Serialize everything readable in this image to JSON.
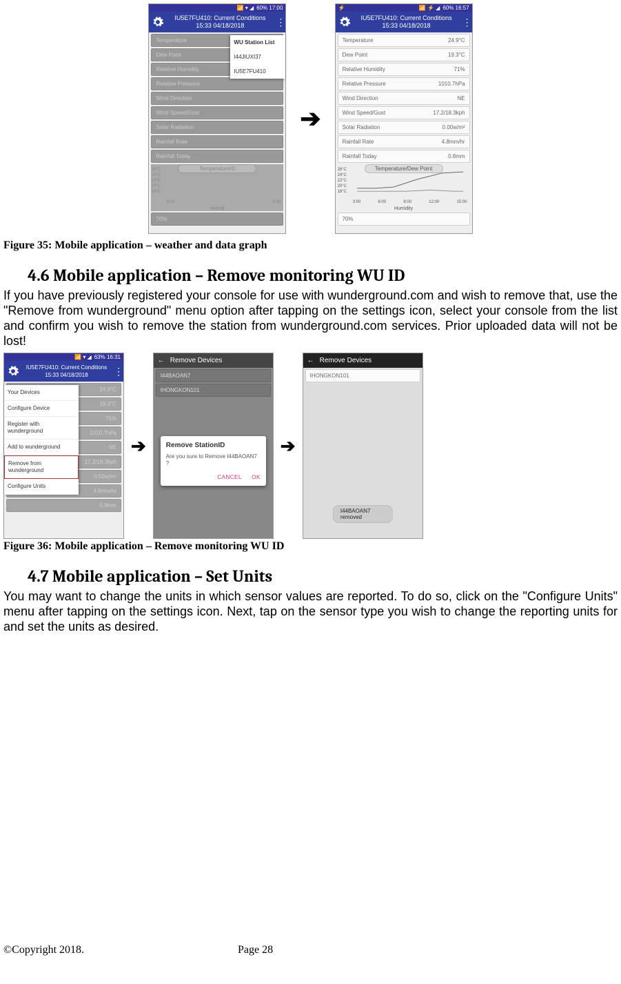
{
  "chart_data": {
    "type": "line",
    "title": "Temperature/Dew Point",
    "xlabel": "Humidity",
    "x_ticks": [
      "3:00",
      "6:00",
      "9:00",
      "12:00",
      "15:00"
    ],
    "y_ticks": [
      "26°C",
      "24°C",
      "22°C",
      "20°C",
      "18°C"
    ],
    "ylim": [
      18,
      26
    ],
    "series": [
      {
        "name": "Temperature",
        "values": [
          20,
          20,
          20.5,
          22,
          24,
          25
        ]
      },
      {
        "name": "Dew Point",
        "values": [
          19,
          19,
          19,
          19.5,
          19,
          19
        ]
      }
    ]
  },
  "fig35": {
    "caption": "Figure 35: Mobile application – weather and data graph",
    "left": {
      "status_right": "60% 17:00",
      "status_prefix": "📶 ▾ ◢",
      "title_line1": "IU5E7FU410: Current Conditions",
      "title_line2": "15:33    04/18/2018",
      "rows": [
        {
          "label": "Temperature",
          "value": ""
        },
        {
          "label": "Dew Point",
          "value": ""
        },
        {
          "label": "Relative Humidity",
          "value": ""
        },
        {
          "label": "Relative Pressure",
          "value": ""
        },
        {
          "label": "Wind Direction",
          "value": ""
        },
        {
          "label": "Wind Speed/Gust",
          "value": ""
        },
        {
          "label": "Solar Radiation",
          "value": ""
        },
        {
          "label": "Rainfall Rate",
          "value": ""
        },
        {
          "label": "Rainfall Today",
          "value": ""
        }
      ],
      "graph_title": "Temperature/D",
      "axis_title": "Humid",
      "bottom_bar": "70%",
      "menu_header": "WU Station List",
      "menu_items": [
        "I44JIUXI37",
        "IU5E7FU410"
      ]
    },
    "right": {
      "status_right": "60% 16:57",
      "status_prefix": "📶 ⚡ ◢",
      "title_line1": "IU5E7FU410: Current Conditions",
      "title_line2": "15:33    04/18/2018",
      "rows": [
        {
          "label": "Temperature",
          "value": "24.9°C"
        },
        {
          "label": "Dew Point",
          "value": "19.3°C"
        },
        {
          "label": "Relative Humidity",
          "value": "71%"
        },
        {
          "label": "Relative Pressure",
          "value": "1010.7hPa"
        },
        {
          "label": "Wind Direction",
          "value": "NE"
        },
        {
          "label": "Wind Speed/Gust",
          "value": "17.2/18.3kph"
        },
        {
          "label": "Solar Radiation",
          "value": "0.00w/m²"
        },
        {
          "label": "Rainfall Rate",
          "value": "4.8mm/hr"
        },
        {
          "label": "Rainfall Today",
          "value": "0.8mm"
        }
      ],
      "graph_title": "Temperature/Dew Point",
      "axis_title": "Humidity",
      "bottom_bar": "70%"
    }
  },
  "section46": {
    "heading": "4.6 Mobile application – Remove monitoring WU ID",
    "body": "If you have previously registered your console for use with wunderground.com and wish to remove that, use the \"Remove from wunderground\" menu option after tapping on the settings icon, select your console from the list and confirm you wish to remove the station from wunderground.com services. Prior uploaded data will not be lost!"
  },
  "fig36": {
    "caption": "Figure 36: Mobile application – Remove monitoring WU ID",
    "left": {
      "status_right": "63% 16:31",
      "status_prefix": "📶 ▾ ◢",
      "title_line1": "IU5E7FU410: Current Conditions",
      "title_line2": "15:33    04/18/2018",
      "back_values": [
        "24.9°C",
        "19.3°C",
        "71%",
        "1010.7hPa",
        "NE",
        "17.2/18.3kph",
        "0.50w/m²",
        "4.8mm/hr",
        "0.8mm"
      ],
      "drawer": [
        "Your Devices",
        "Configure Device",
        "Register with\nwunderground",
        "Add to wunderground",
        "Remove from\nwunderground",
        "Configure Units"
      ],
      "drawer_selected_index": 4
    },
    "mid": {
      "header": "Remove Devices",
      "items": [
        "I44BAOAN7",
        "IHONGKON101"
      ],
      "dialog_title": "Remove StationID",
      "dialog_body": "Are you sure to Remove I44BAOAN7 ?",
      "dialog_cancel": "CANCEL",
      "dialog_ok": "OK"
    },
    "right": {
      "header": "Remove Devices",
      "items": [
        "IHONGKON101"
      ],
      "toast": "I44BAOAN7 removed"
    }
  },
  "section47": {
    "heading": "4.7 Mobile application – Set Units",
    "body": "You may want to change the units in which sensor values are reported. To do so, click on the \"Configure Units\" menu after tapping on the settings icon. Next, tap on the sensor type you wish to change the reporting units for and set the units as desired."
  },
  "footer": {
    "copyright": "©Copyright 2018.",
    "page": "Page 28"
  }
}
